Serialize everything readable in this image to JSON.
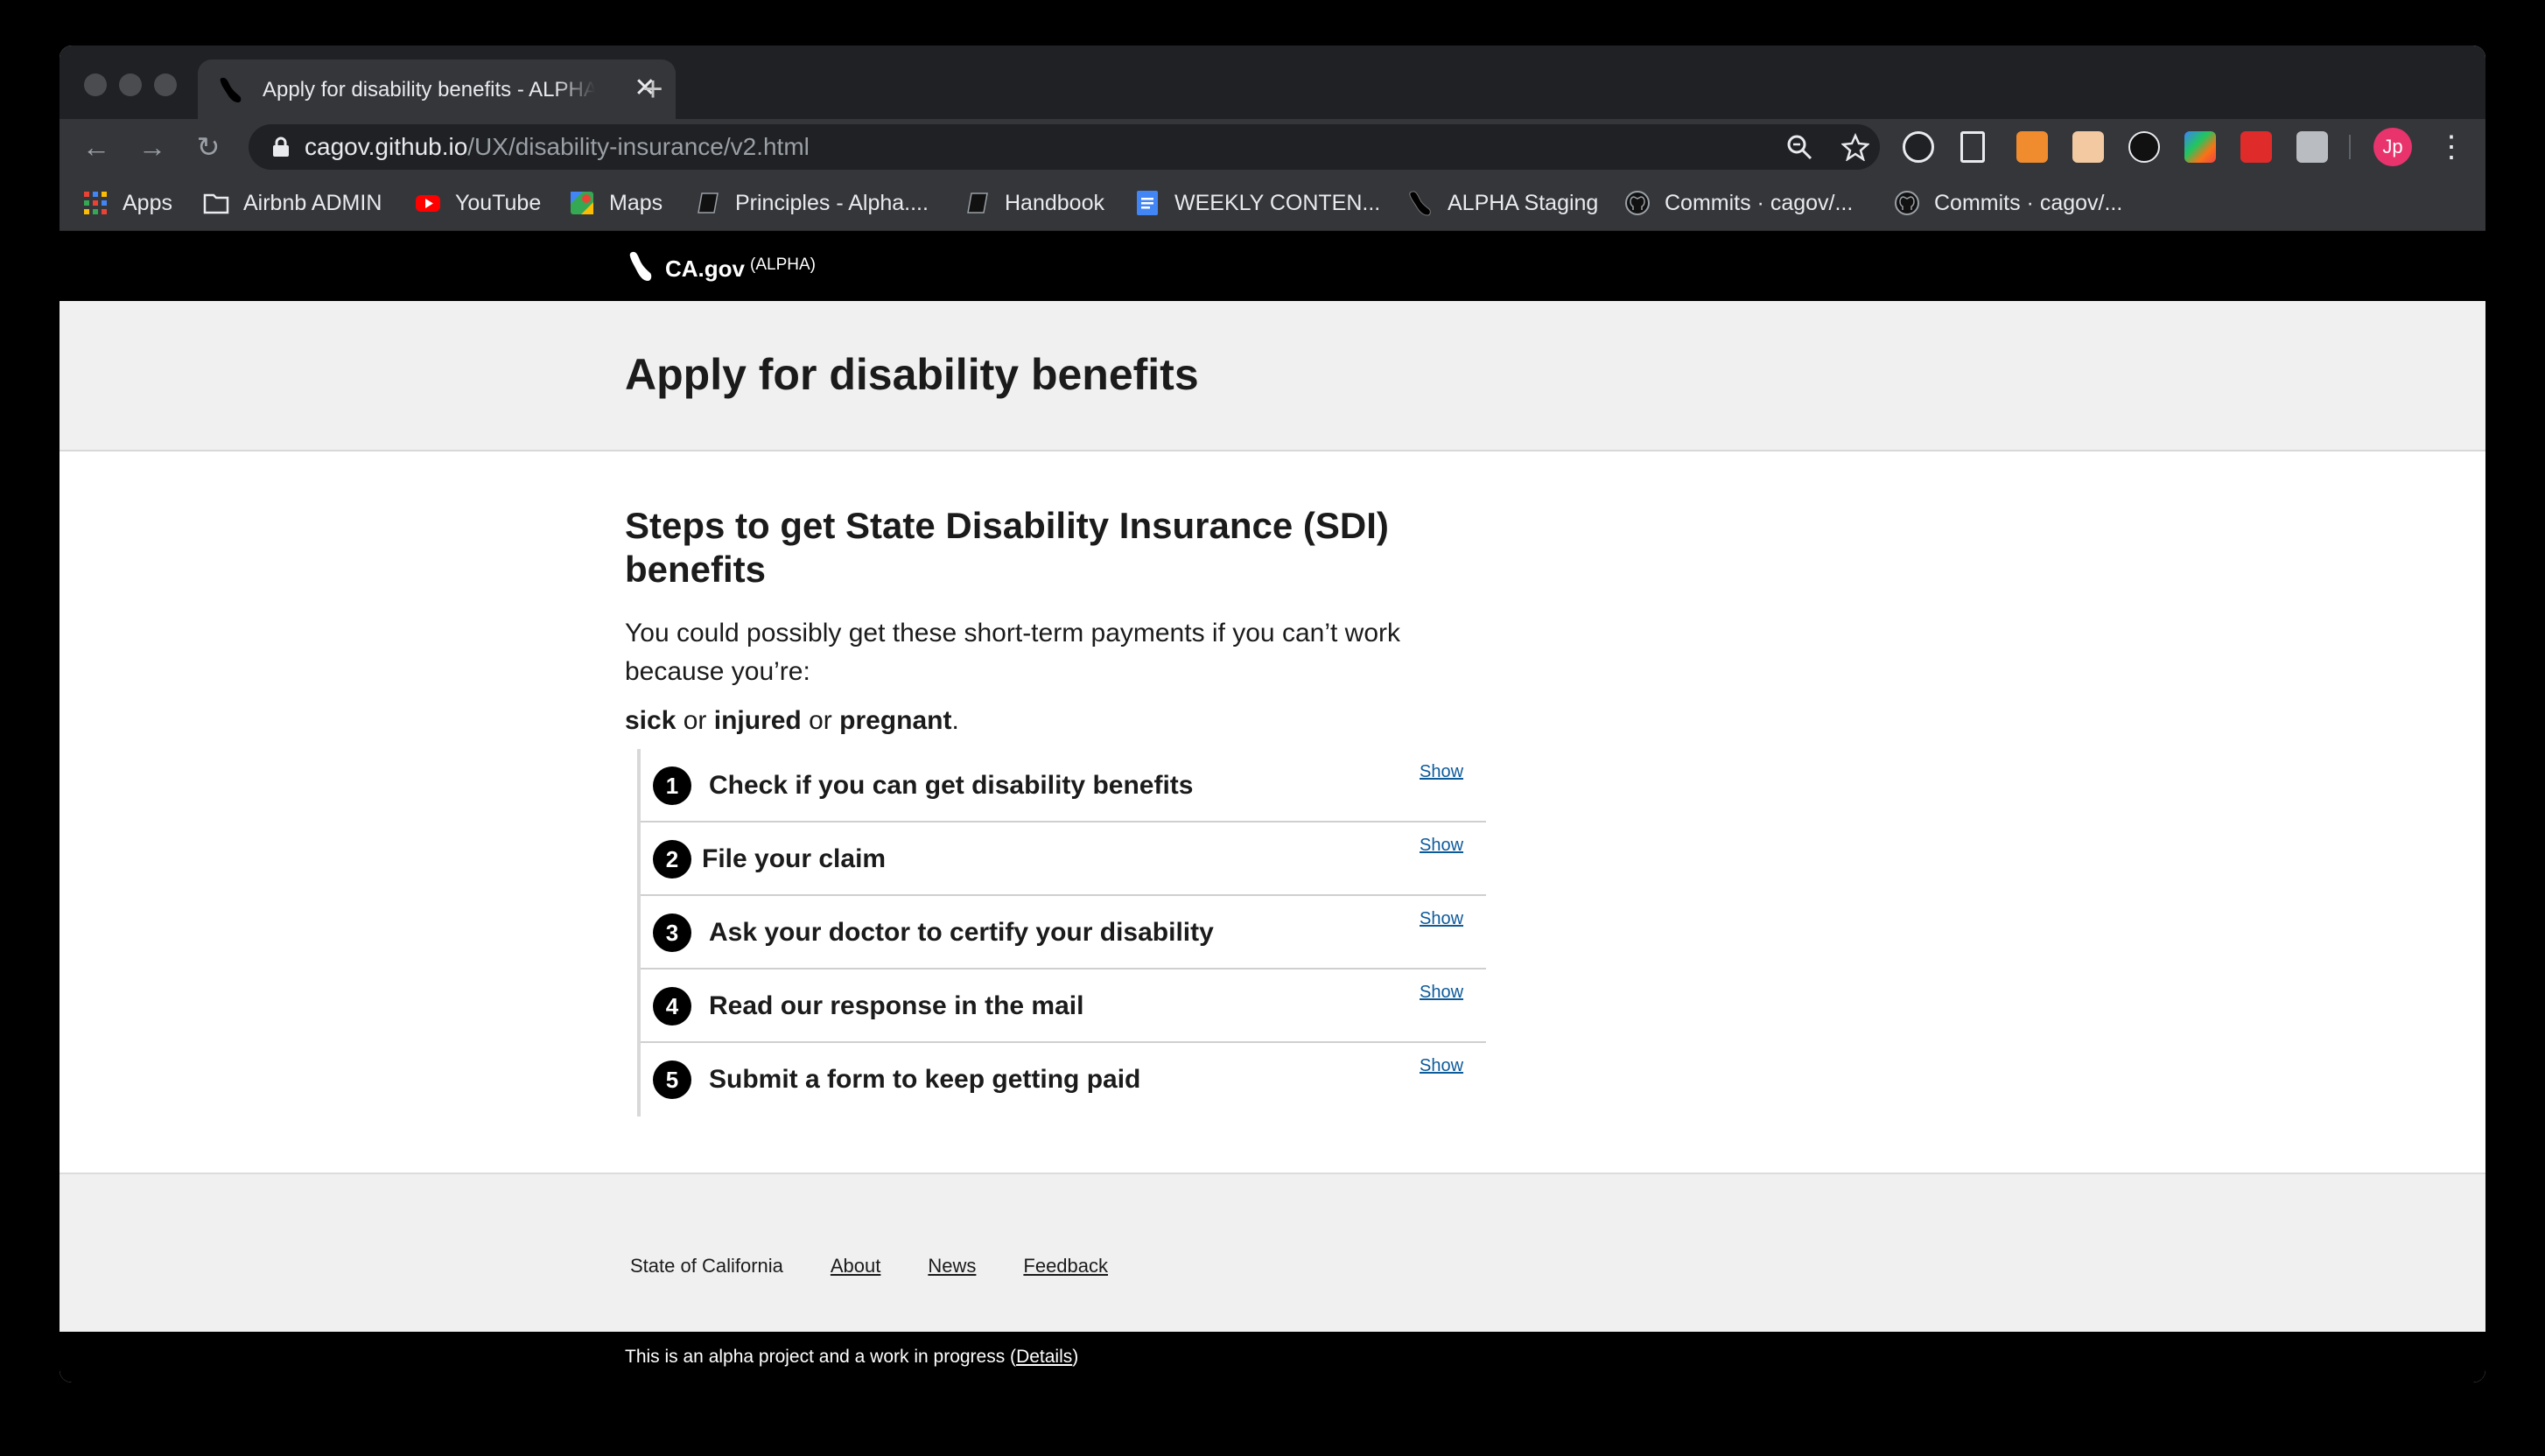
{
  "browser": {
    "tab_title": "Apply for disability benefits - ALPHA",
    "close_glyph": "✕",
    "new_tab_glyph": "+",
    "url_host": "cagov.github.io",
    "url_path": "/UX/disability-insurance/v2.html",
    "profile_initials": "Jp",
    "nav": {
      "back": "←",
      "forward": "→",
      "reload": "↻"
    },
    "menu_glyph": "⋮"
  },
  "bookmarks": [
    {
      "label": "Apps",
      "icon": "apps-grid-icon"
    },
    {
      "label": "Airbnb ADMIN",
      "icon": "folder-icon"
    },
    {
      "label": "YouTube",
      "icon": "youtube-icon"
    },
    {
      "label": "Maps",
      "icon": "maps-icon"
    },
    {
      "label": "Principles - Alpha....",
      "icon": "notebook-icon"
    },
    {
      "label": "Handbook",
      "icon": "notebook-icon"
    },
    {
      "label": "WEEKLY CONTEN...",
      "icon": "google-docs-icon"
    },
    {
      "label": "ALPHA Staging",
      "icon": "ca-bear-icon"
    },
    {
      "label": "Commits · cagov/...",
      "icon": "github-icon"
    },
    {
      "label": "Commits · cagov/...",
      "icon": "github-icon"
    }
  ],
  "site": {
    "name": "CA.gov",
    "badge": "(ALPHA)",
    "page_title": "Apply for disability benefits",
    "heading": "Steps to get State Disability Insurance (SDI) benefits",
    "intro": "You could possibly get these short-term payments if you can’t work because you’re:",
    "conditions": {
      "a": "sick",
      "or1": " or ",
      "b": "injured",
      "or2": " or ",
      "c": "pregnant",
      "end": "."
    },
    "steps": [
      {
        "num": "1",
        "title": "Check if you can get disability benefits",
        "toggle": "Show"
      },
      {
        "num": "2",
        "title": "File your claim",
        "toggle": "Show"
      },
      {
        "num": "3",
        "title": "Ask your doctor to certify your disability",
        "toggle": "Show"
      },
      {
        "num": "4",
        "title": "Read our response in the mail",
        "toggle": "Show"
      },
      {
        "num": "5",
        "title": "Submit a form to keep getting paid",
        "toggle": "Show"
      }
    ],
    "footer": {
      "state": "State of California",
      "links": [
        "About",
        "News",
        "Feedback"
      ]
    },
    "alpha_notice": {
      "text": "This is an alpha project and a work in progress (",
      "link": "Details",
      "end": ")"
    }
  },
  "colors": {
    "link": "#0d5a9a",
    "header_bg": "#000000",
    "hero_bg": "#f0f0f0",
    "profile": "#e8336d"
  }
}
